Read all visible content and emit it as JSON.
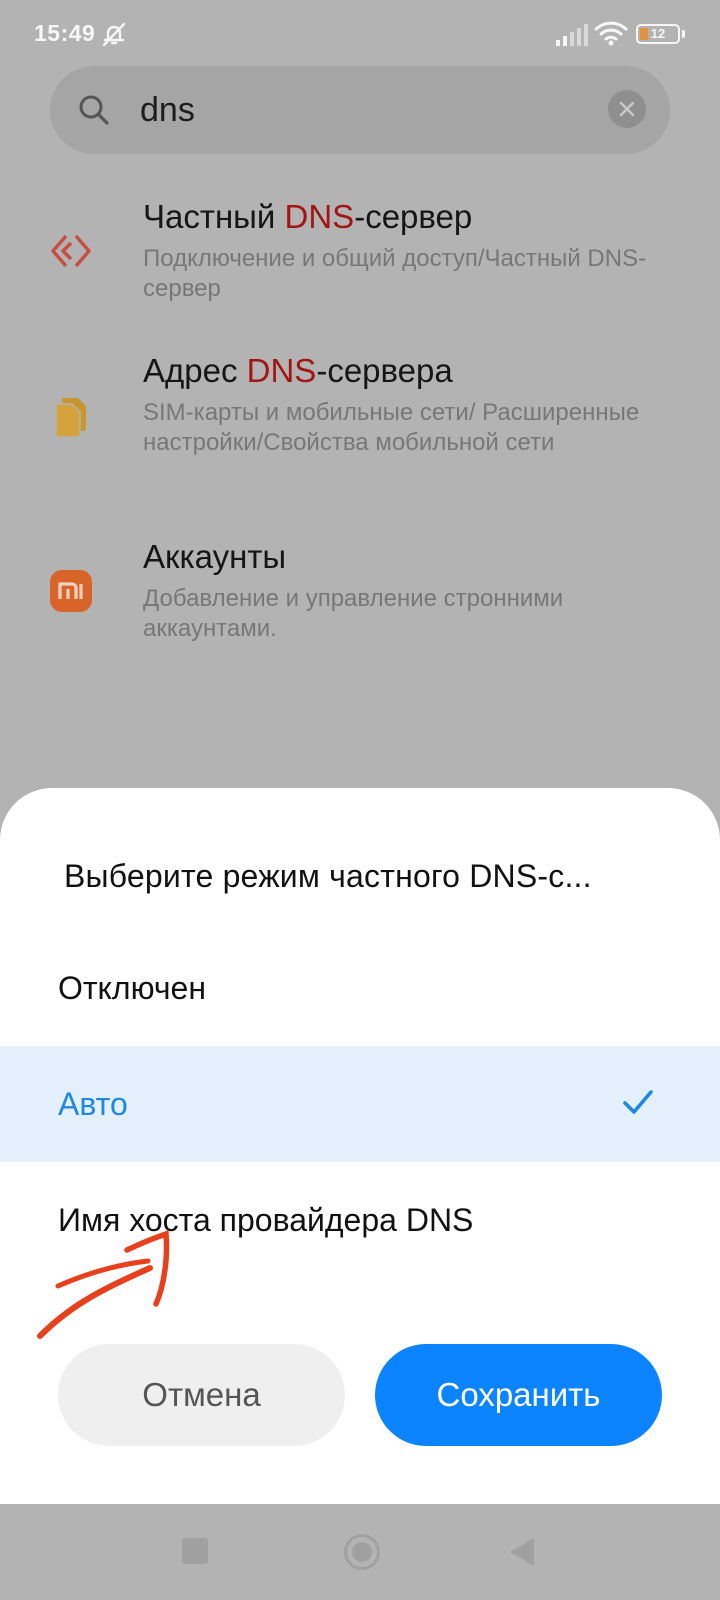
{
  "status_bar": {
    "time": "15:49",
    "battery_level": "12",
    "icons": [
      "bell-off-icon",
      "signal-icon",
      "wifi-icon",
      "battery-icon"
    ]
  },
  "search": {
    "value": "dns",
    "icon": "search-icon",
    "clear_icon": "close-icon"
  },
  "results": [
    {
      "title_before": "Частный ",
      "title_highlight": "DNS",
      "title_after": "-сервер",
      "path": "Подключение и общий доступ/Частный DNS-сервер",
      "icon": "private-dns-icon",
      "icon_color": "#d9534f"
    },
    {
      "title_before": "Адрес ",
      "title_highlight": "DNS",
      "title_after": "-сервера",
      "path": "SIM-карты и мобильные сети/ Расширенные настройки/Свойства мобильной сети",
      "icon": "sim-card-icon",
      "icon_color": "#d8a23a"
    },
    {
      "title_before": "Аккаунты",
      "title_highlight": "",
      "title_after": "",
      "path": "Добавление и управление стронними аккаунтами.",
      "icon": "mi-logo-icon",
      "icon_color": "#e2662b"
    }
  ],
  "dialog": {
    "title": "Выберите режим частного DNS-с...",
    "options": [
      {
        "label": "Отключен",
        "selected": false
      },
      {
        "label": "Авто",
        "selected": true
      },
      {
        "label": "Имя хоста провайдера DNS",
        "selected": false
      }
    ],
    "cancel_label": "Отмена",
    "save_label": "Сохранить",
    "accent_color": "#0d84ff",
    "selected_background": "#e4f0fd"
  },
  "annotation": {
    "type": "hand-drawn-arrow",
    "color": "#e8401c"
  },
  "navigation": {
    "buttons": [
      "recents-icon",
      "home-icon",
      "back-icon"
    ]
  }
}
